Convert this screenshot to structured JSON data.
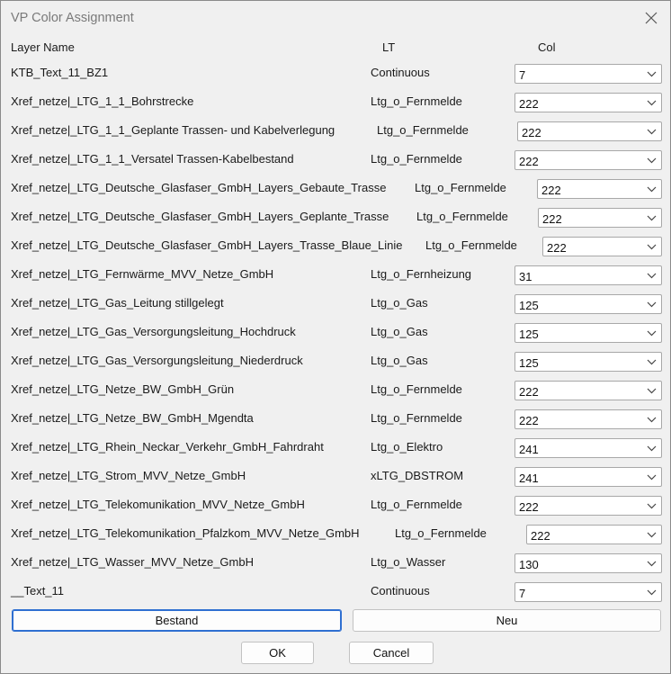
{
  "window": {
    "title": "VP Color Assignment"
  },
  "headers": {
    "layer": "Layer Name",
    "lt": "LT",
    "col": "Col"
  },
  "rows": [
    {
      "layer": "KTB_Text_11_BZ1",
      "lt": "Continuous",
      "col": "7"
    },
    {
      "layer": "Xref_netze|_LTG_1_1_Bohrstrecke",
      "lt": "Ltg_o_Fernmelde",
      "col": "222"
    },
    {
      "layer": "Xref_netze|_LTG_1_1_Geplante Trassen- und Kabelverlegung",
      "lt": "Ltg_o_Fernmelde",
      "col": "222"
    },
    {
      "layer": "Xref_netze|_LTG_1_1_Versatel Trassen-Kabelbestand",
      "lt": "Ltg_o_Fernmelde",
      "col": "222"
    },
    {
      "layer": "Xref_netze|_LTG_Deutsche_Glasfaser_GmbH_Layers_Gebaute_Trasse",
      "lt": "Ltg_o_Fernmelde",
      "col": "222"
    },
    {
      "layer": "Xref_netze|_LTG_Deutsche_Glasfaser_GmbH_Layers_Geplante_Trasse",
      "lt": "Ltg_o_Fernmelde",
      "col": "222"
    },
    {
      "layer": "Xref_netze|_LTG_Deutsche_Glasfaser_GmbH_Layers_Trasse_Blaue_Linie",
      "lt": "Ltg_o_Fernmelde",
      "col": "222"
    },
    {
      "layer": "Xref_netze|_LTG_Fernwärme_MVV_Netze_GmbH",
      "lt": "Ltg_o_Fernheizung",
      "col": "31"
    },
    {
      "layer": "Xref_netze|_LTG_Gas_Leitung stillgelegt",
      "lt": "Ltg_o_Gas",
      "col": "125"
    },
    {
      "layer": "Xref_netze|_LTG_Gas_Versorgungsleitung_Hochdruck",
      "lt": "Ltg_o_Gas",
      "col": "125"
    },
    {
      "layer": "Xref_netze|_LTG_Gas_Versorgungsleitung_Niederdruck",
      "lt": "Ltg_o_Gas",
      "col": "125"
    },
    {
      "layer": "Xref_netze|_LTG_Netze_BW_GmbH_Grün",
      "lt": "Ltg_o_Fernmelde",
      "col": "222"
    },
    {
      "layer": "Xref_netze|_LTG_Netze_BW_GmbH_Mgendta",
      "lt": "Ltg_o_Fernmelde",
      "col": "222"
    },
    {
      "layer": "Xref_netze|_LTG_Rhein_Neckar_Verkehr_GmbH_Fahrdraht",
      "lt": "Ltg_o_Elektro",
      "col": "241"
    },
    {
      "layer": "Xref_netze|_LTG_Strom_MVV_Netze_GmbH",
      "lt": "xLTG_DBSTROM",
      "col": "241"
    },
    {
      "layer": "Xref_netze|_LTG_Telekomunikation_MVV_Netze_GmbH",
      "lt": "Ltg_o_Fernmelde",
      "col": "222"
    },
    {
      "layer": "Xref_netze|_LTG_Telekomunikation_Pfalzkom_MVV_Netze_GmbH",
      "lt": "Ltg_o_Fernmelde",
      "col": "222"
    },
    {
      "layer": "Xref_netze|_LTG_Wasser_MVV_Netze_GmbH",
      "lt": "Ltg_o_Wasser",
      "col": "130"
    },
    {
      "layer": "__Text_11",
      "lt": "Continuous",
      "col": "7"
    }
  ],
  "buttons": {
    "bestand": "Bestand",
    "neu": "Neu",
    "ok": "OK",
    "cancel": "Cancel"
  },
  "icons": {
    "close": "close-icon",
    "dropdown": "chevron-down-icon"
  },
  "colors": {
    "focus_border": "#2f6fd1"
  }
}
